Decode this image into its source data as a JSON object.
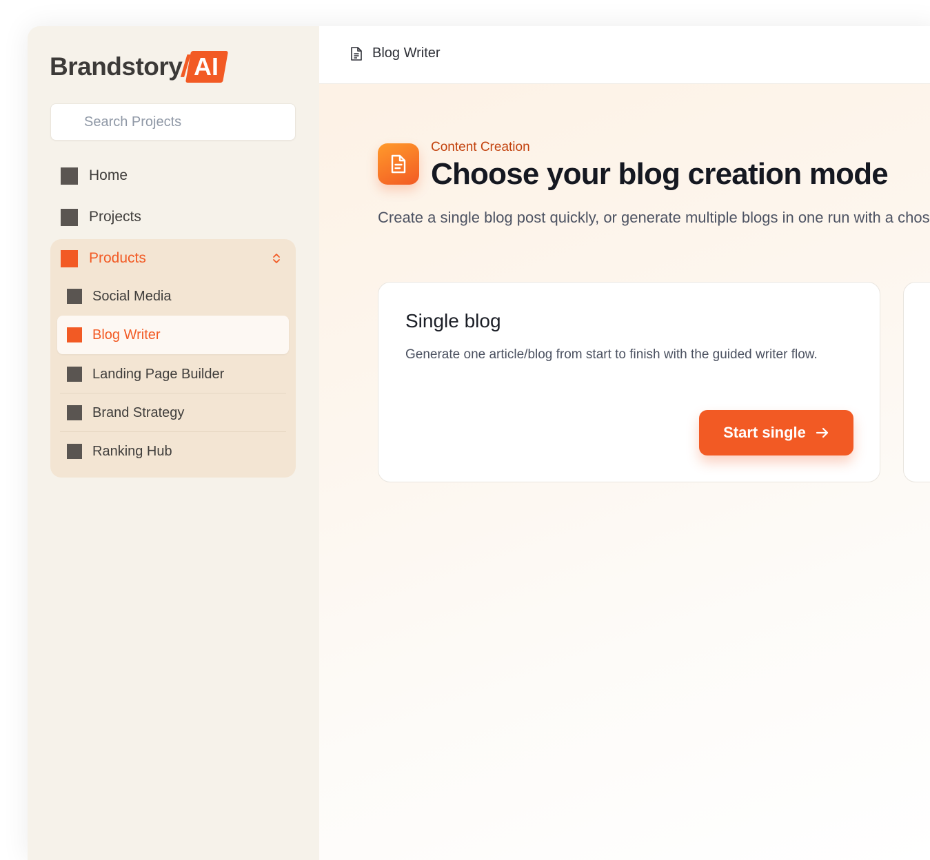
{
  "brand": {
    "name": "Brandstory",
    "slash": "/",
    "badge": "AI",
    "accent_color": "#f25a24"
  },
  "sidebar": {
    "search": {
      "placeholder": "Search Projects",
      "value": ""
    },
    "items": [
      {
        "label": "Home",
        "icon": "home-icon"
      },
      {
        "label": "Projects",
        "icon": "projects-icon"
      }
    ],
    "products": {
      "label": "Products",
      "expanded": true,
      "sub_items": [
        {
          "label": "Social Media",
          "active": false
        },
        {
          "label": "Blog Writer",
          "active": true
        },
        {
          "label": "Landing Page Builder",
          "active": false
        },
        {
          "label": "Brand Strategy",
          "active": false
        },
        {
          "label": "Ranking Hub",
          "active": false
        }
      ]
    }
  },
  "topbar": {
    "title": "Blog Writer",
    "icon": "document-icon"
  },
  "main": {
    "eyebrow": "Content Creation",
    "title": "Choose your blog creation mode",
    "description": "Create a single blog post quickly, or generate multiple blogs in one run with a chosen count.",
    "cards": [
      {
        "title": "Single blog",
        "description": "Generate one article/blog from start to finish with the guided writer flow.",
        "button_label": "Start single"
      }
    ]
  }
}
